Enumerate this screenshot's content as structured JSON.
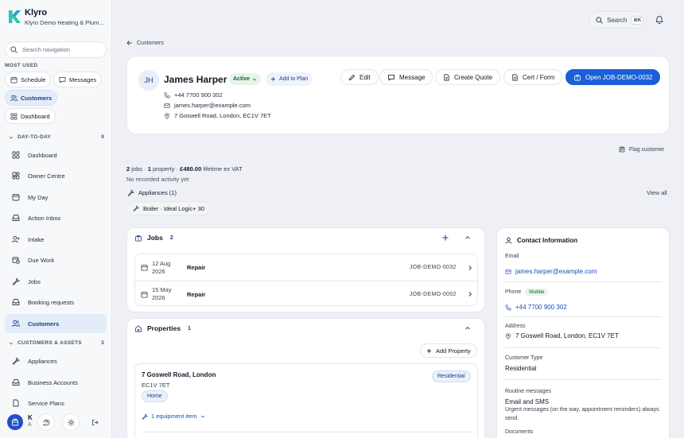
{
  "brand": {
    "name": "Klyro",
    "subtitle": "Klyro Demo Heating & Plum..."
  },
  "sidebar": {
    "search_placeholder": "Search navigation",
    "most_used_label": "MOST USED",
    "most_used": [
      {
        "label": "Schedule",
        "icon": "calendar-icon"
      },
      {
        "label": "Messages",
        "icon": "message-icon"
      },
      {
        "label": "Customers",
        "icon": "users-icon",
        "active": true
      },
      {
        "label": "Dashboard",
        "icon": "grid-icon"
      }
    ],
    "sections": [
      {
        "label": "DAY-TO-DAY",
        "count": "9"
      },
      {
        "label": "CUSTOMERS & ASSETS",
        "count": "3"
      }
    ],
    "items": [
      {
        "label": "Dashboard",
        "icon": "grid-icon"
      },
      {
        "label": "Owner Centre",
        "icon": "squares-icon"
      },
      {
        "label": "My Day",
        "icon": "calendar-icon"
      },
      {
        "label": "Action Inbox",
        "icon": "inbox-icon"
      },
      {
        "label": "Intake",
        "icon": "user-plus-icon"
      },
      {
        "label": "Due Work",
        "icon": "calendar-clock-icon"
      },
      {
        "label": "Jobs",
        "icon": "wrench-icon"
      },
      {
        "label": "Booking requests",
        "icon": "inbox-icon"
      },
      {
        "label": "Customers",
        "icon": "users-icon",
        "active": true
      },
      {
        "label": "Appliances",
        "icon": "wrench-icon"
      },
      {
        "label": "Business Accounts",
        "icon": "inbox-icon"
      },
      {
        "label": "Service Plans",
        "icon": "document-icon"
      }
    ],
    "footer": {
      "initial": "K",
      "sub": "A"
    }
  },
  "topbar": {
    "search_label": "Search",
    "shortcut": "⌘K"
  },
  "breadcrumb": {
    "label": "Customers"
  },
  "customer": {
    "initials": "JH",
    "name": "James Harper",
    "status": "Active",
    "add_plan": "Add to Plan",
    "phone": "+44 7700 900 302",
    "email": "james.harper@example.com",
    "address": "7 Goswell Road, London, EC1V 7ET"
  },
  "actions": {
    "edit": "Edit",
    "message": "Message",
    "create_quote": "Create Quote",
    "cert_form": "Cert / Form",
    "open_job": "Open JOB-DEMO-0032"
  },
  "flag_customer": "Flag customer",
  "summary": {
    "jobs_count": "2",
    "jobs_word": "jobs",
    "properties_count": "1",
    "property_word": "property",
    "lifetime": "£480.00",
    "lifetime_suffix": "lifetime ex VAT",
    "activity": "No recorded activity yet"
  },
  "appliances": {
    "heading": "Appliances (1)",
    "view_all": "View all",
    "chip": "Boiler · Ideal Logic+ 30"
  },
  "jobs": {
    "title": "Jobs",
    "count": "2",
    "rows": [
      {
        "date_line1": "12 Aug",
        "date_line2": "2026",
        "type": "Repair",
        "id": "JOB-DEMO-0032"
      },
      {
        "date_line1": "15 May",
        "date_line2": "2026",
        "type": "Repair",
        "id": "JOB-DEMO-0002"
      }
    ]
  },
  "properties": {
    "title": "Properties",
    "count": "1",
    "add_label": "Add Property",
    "item": {
      "line1": "7 Goswell Road, London",
      "postcode": "EC1V 7ET",
      "tag": "Home",
      "type": "Residential",
      "equipment": "1 equipment item"
    }
  },
  "contact_info": {
    "title": "Contact Information",
    "email_label": "Email",
    "email": "james.harper@example.com",
    "phone_label": "Phone",
    "phone_badge": "Mobile",
    "phone": "+44 7700 900 302",
    "address_label": "Address",
    "address": "7 Goswell Road, London, EC1V 7ET",
    "type_label": "Customer Type",
    "type": "Residential",
    "routine_label": "Routine messages",
    "routine": "Email and SMS",
    "urgent_note": "Urgent messages (on the way, appointment reminders) always send.",
    "documents_label": "Documents"
  },
  "colors": {
    "accent": "#1a5fd8",
    "active_bg": "#e3edf9",
    "success": "#166534"
  }
}
